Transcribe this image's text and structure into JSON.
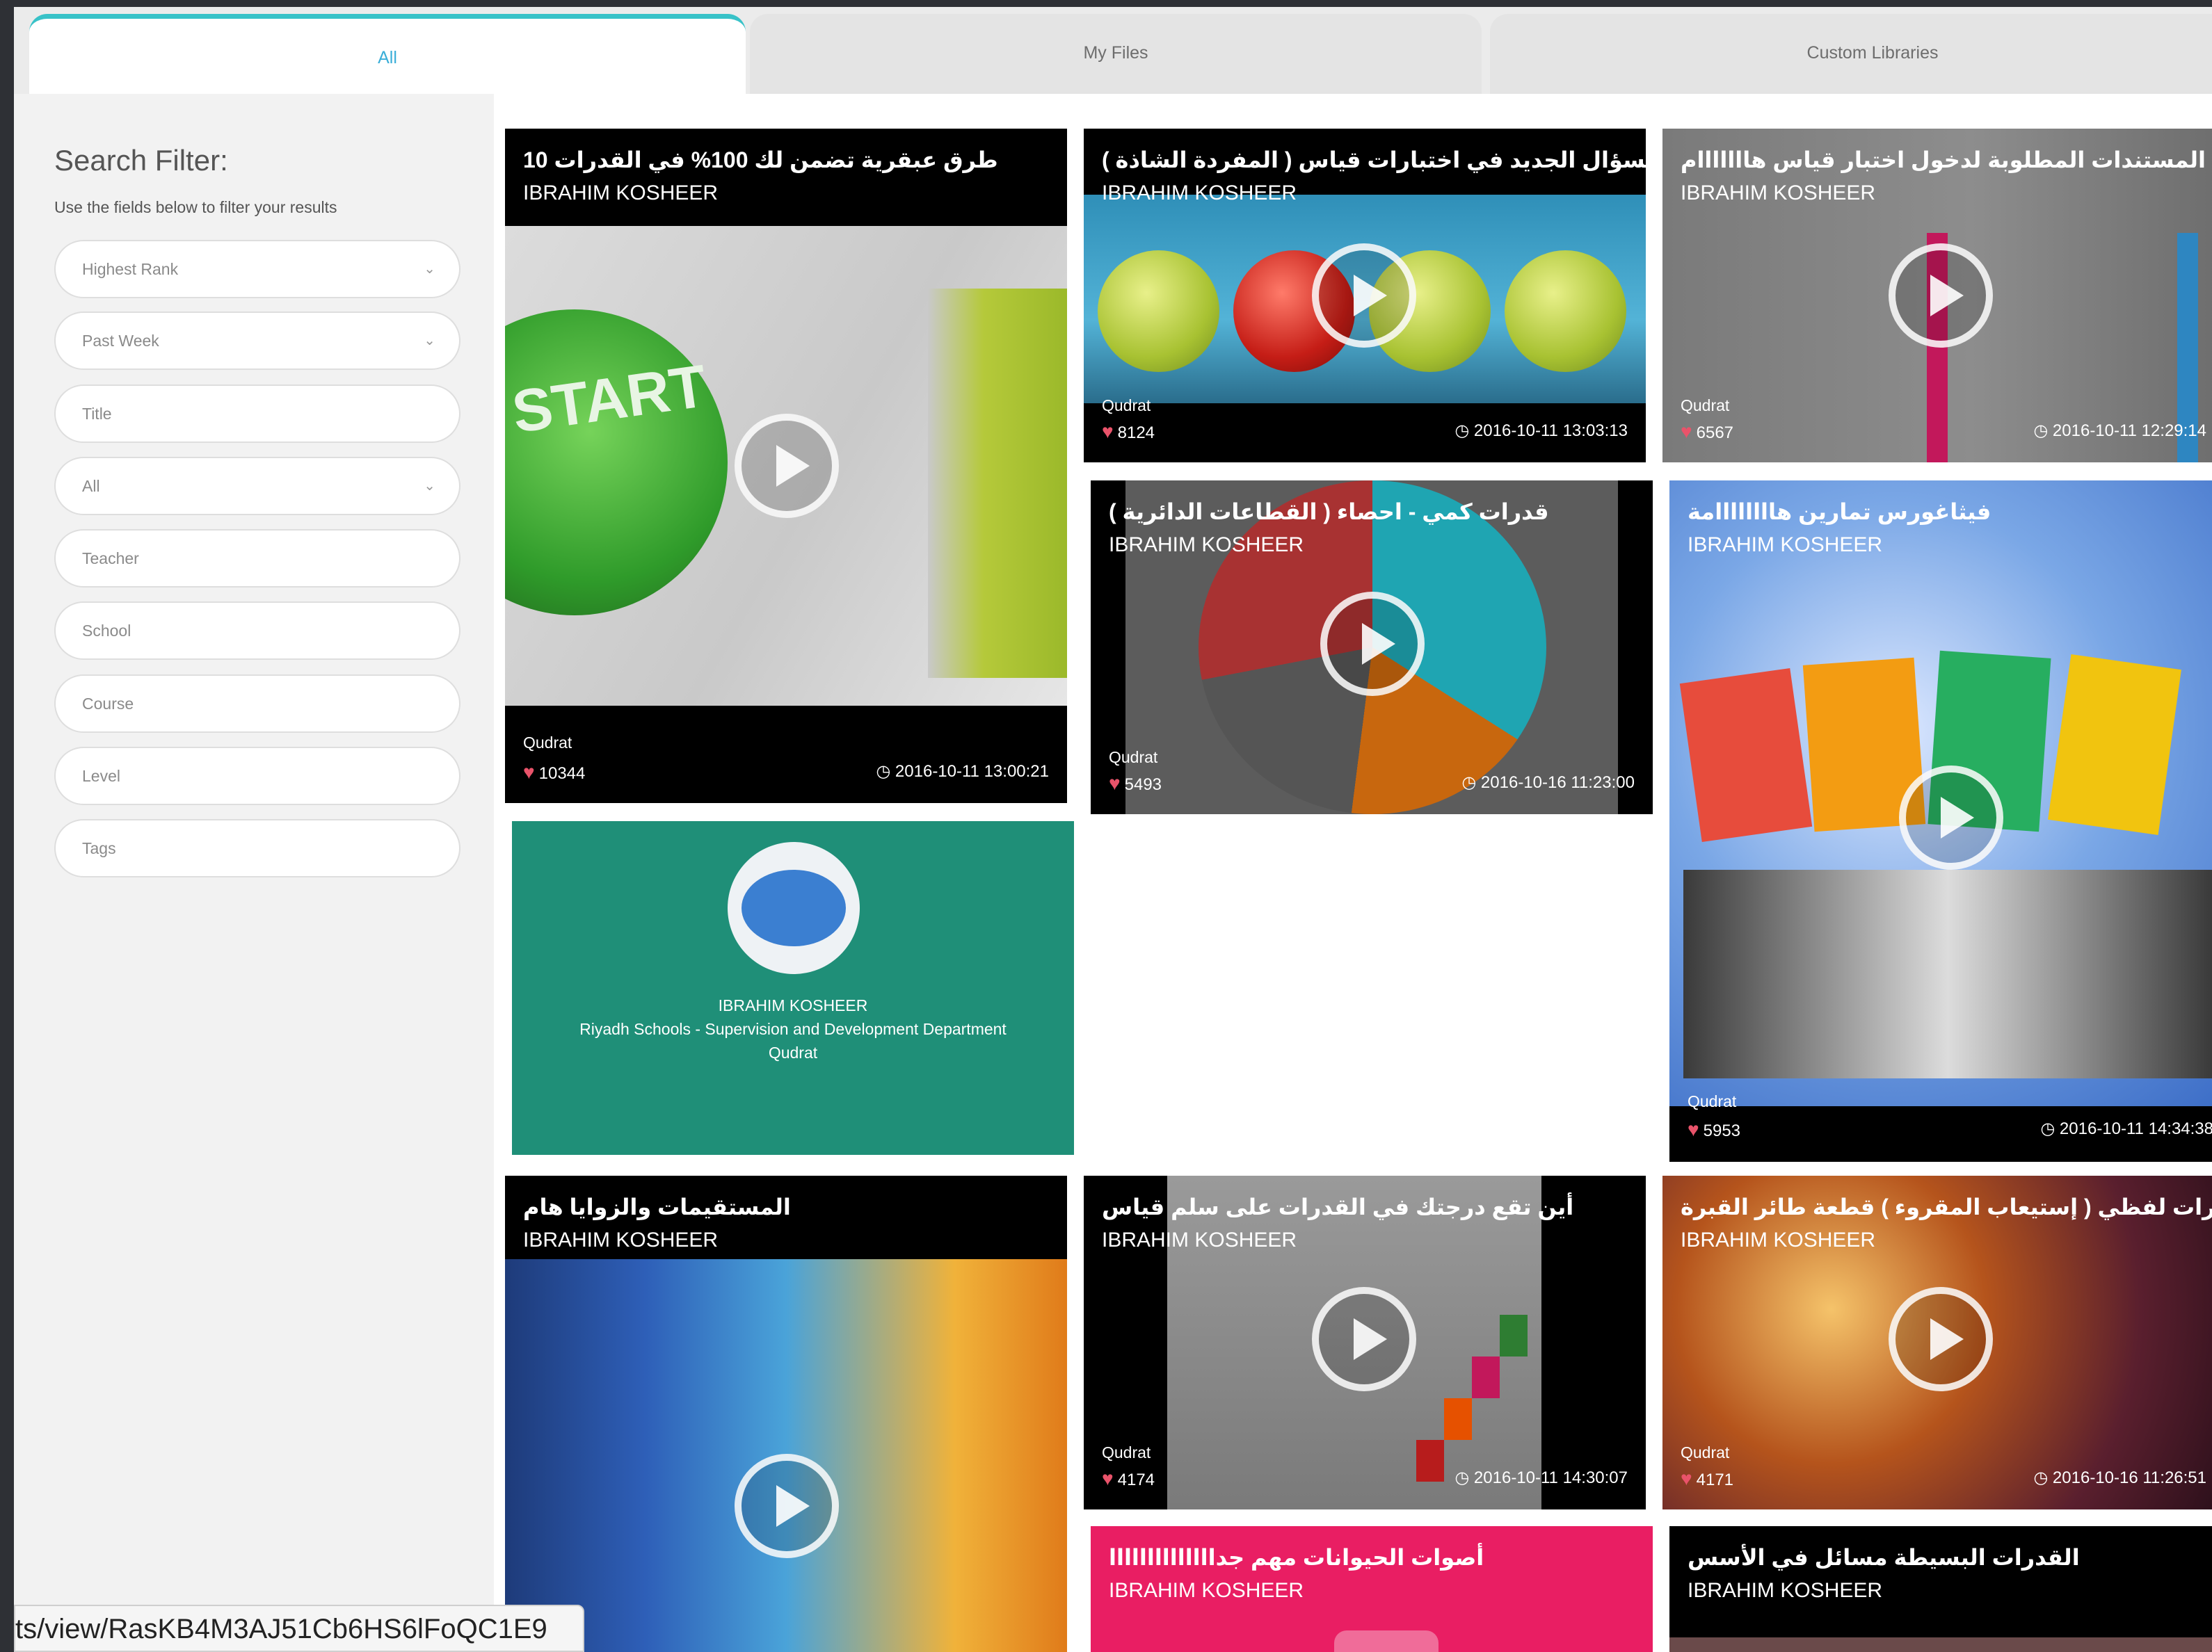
{
  "tabs": [
    {
      "label": "All",
      "active": true
    },
    {
      "label": "My Files",
      "active": false
    },
    {
      "label": "Custom Libraries",
      "active": false
    }
  ],
  "sidebar": {
    "title": "Search Filter:",
    "description": "Use the fields below to filter your results",
    "fields": [
      {
        "kind": "select",
        "value": "Highest Rank"
      },
      {
        "kind": "select",
        "value": "Past Week"
      },
      {
        "kind": "input",
        "placeholder": "Title"
      },
      {
        "kind": "select",
        "value": "All"
      },
      {
        "kind": "input",
        "placeholder": "Teacher"
      },
      {
        "kind": "input",
        "placeholder": "School"
      },
      {
        "kind": "input",
        "placeholder": "Course"
      },
      {
        "kind": "input",
        "placeholder": "Level"
      },
      {
        "kind": "input",
        "placeholder": "Tags"
      }
    ]
  },
  "cards": [
    {
      "title": "طرق عبقرية تضمن لك 100% في القدرات 10",
      "author": "IBRAHIM KOSHEER",
      "category": "Qudrat",
      "likes": "10344",
      "date": "2016-10-11 13:00:21",
      "thumb_text": "START"
    },
    {
      "title": "السؤال الجديد في اختبارات قياس ( المفردة الشاذة )",
      "author": "IBRAHIM KOSHEER",
      "category": "Qudrat",
      "likes": "8124",
      "date": "2016-10-11 13:03:13"
    },
    {
      "title": "المستندات المطلوبة لدخول اختبار قياس هااااااام",
      "author": "IBRAHIM KOSHEER",
      "category": "Qudrat",
      "likes": "6567",
      "date": "2016-10-11 12:29:14"
    },
    {
      "title": "قدرات كمي - احصاء ( القطاعات الدائرية )",
      "author": "IBRAHIM KOSHEER",
      "category": "Qudrat",
      "likes": "5493",
      "date": "2016-10-16 11:23:00"
    },
    {
      "title": "فيثاغورس تمارين هاااااااامة",
      "author": "IBRAHIM KOSHEER",
      "category": "Qudrat",
      "likes": "5953",
      "date": "2016-10-11 14:34:38"
    },
    {
      "title": "المستقيمات والزوايا هام",
      "author": "IBRAHIM KOSHEER"
    },
    {
      "title": "أين تقع درجتك في القدرات على سلم قياس",
      "author": "IBRAHIM KOSHEER",
      "category": "Qudrat",
      "likes": "4174",
      "date": "2016-10-11 14:30:07"
    },
    {
      "title": "قدرات لفظي ( إستيعاب المقروء ) قطعة طائر القبرة",
      "author": "IBRAHIM KOSHEER",
      "category": "Qudrat",
      "likes": "4171",
      "date": "2016-10-16 11:26:51"
    },
    {
      "title": "أصوات الحيوانات مهم جداااااااااااااا",
      "author": "IBRAHIM KOSHEER"
    },
    {
      "title": "القدرات البسيطة مسائل في الأسس",
      "author": "IBRAHIM KOSHEER"
    }
  ],
  "profile": {
    "name": "IBRAHIM KOSHEER",
    "school": "Riyadh Schools - Supervision and Development Department",
    "course": "Qudrat"
  },
  "status_url": "ts/view/RasKB4M3AJ51Cb6HS6lFoQC1E9",
  "colors": {
    "accent": "#38c2c8",
    "profile_bg": "#1f8f78",
    "pink_card": "#e91e63",
    "heart": "#e9536a"
  }
}
